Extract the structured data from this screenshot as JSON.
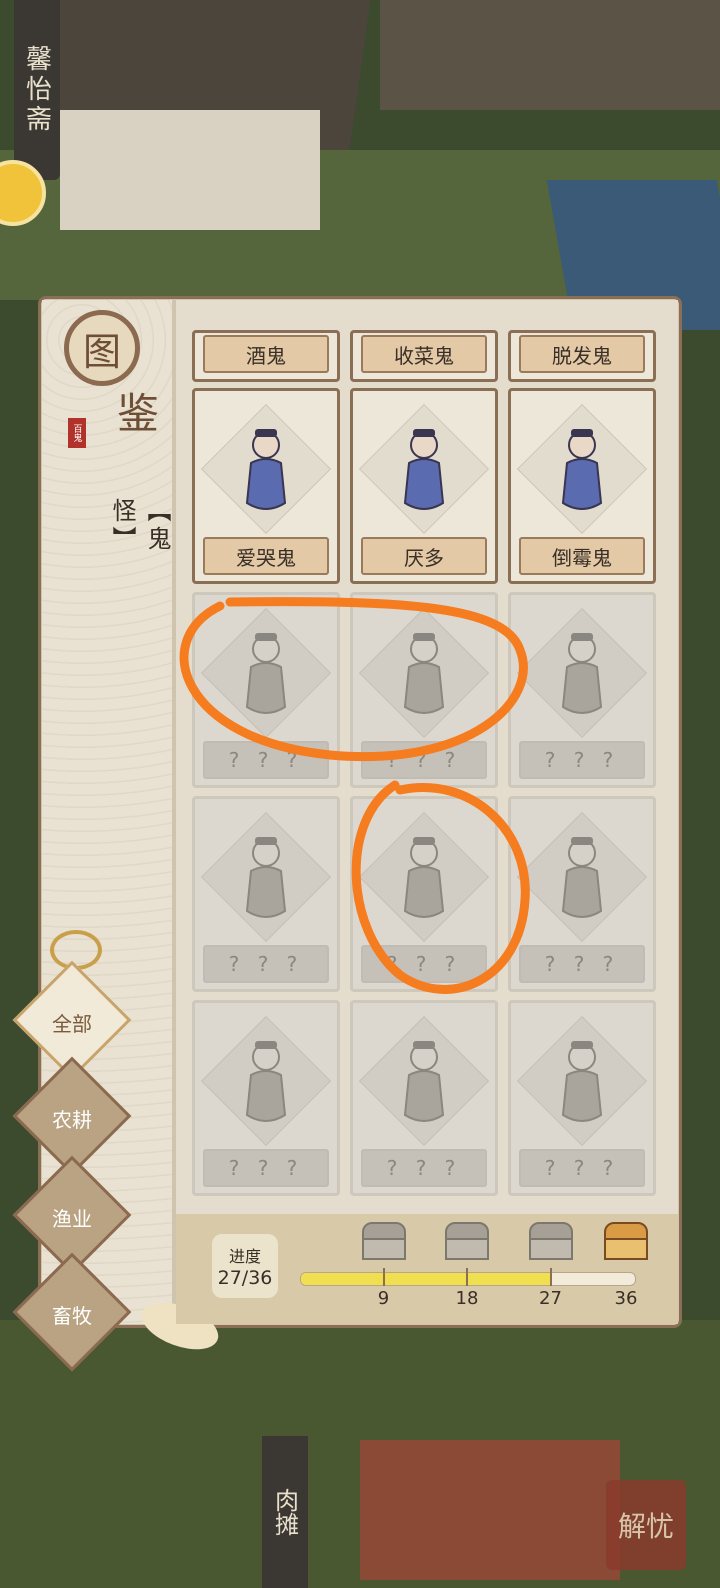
{
  "background": {
    "shop_sign": "馨怡斋",
    "market_sign": "肉摊",
    "bottom_button": "解忧"
  },
  "panel": {
    "logo_char_1": "图",
    "logo_char_2": "鉴",
    "seal_text": "百鬼",
    "category": "【鬼怪】"
  },
  "grid": {
    "top_row": [
      {
        "name": "酒鬼",
        "unlocked": true
      },
      {
        "name": "收菜鬼",
        "unlocked": true
      },
      {
        "name": "脱发鬼",
        "unlocked": true
      }
    ],
    "rows": [
      [
        {
          "name": "爱哭鬼",
          "unlocked": true
        },
        {
          "name": "厌多",
          "unlocked": true
        },
        {
          "name": "倒霉鬼",
          "unlocked": true
        }
      ],
      [
        {
          "name": "? ? ?",
          "unlocked": false
        },
        {
          "name": "? ? ?",
          "unlocked": false
        },
        {
          "name": "? ? ?",
          "unlocked": false
        }
      ],
      [
        {
          "name": "? ? ?",
          "unlocked": false
        },
        {
          "name": "? ? ?",
          "unlocked": false
        },
        {
          "name": "? ? ?",
          "unlocked": false
        }
      ],
      [
        {
          "name": "? ? ?",
          "unlocked": false
        },
        {
          "name": "? ? ?",
          "unlocked": false
        },
        {
          "name": "? ? ?",
          "unlocked": false
        }
      ]
    ]
  },
  "tabs": [
    {
      "label": "全部",
      "active": true
    },
    {
      "label": "农耕",
      "active": false
    },
    {
      "label": "渔业",
      "active": false
    },
    {
      "label": "畜牧",
      "active": false
    }
  ],
  "progress": {
    "label": "进度",
    "value_text": "27/36",
    "current": 27,
    "total": 36,
    "milestones": [
      "9",
      "18",
      "27",
      "36"
    ]
  },
  "colors": {
    "accent_border": "#8b6f55",
    "progress_fill": "#f0e050",
    "annotation": "#f57c1f"
  }
}
